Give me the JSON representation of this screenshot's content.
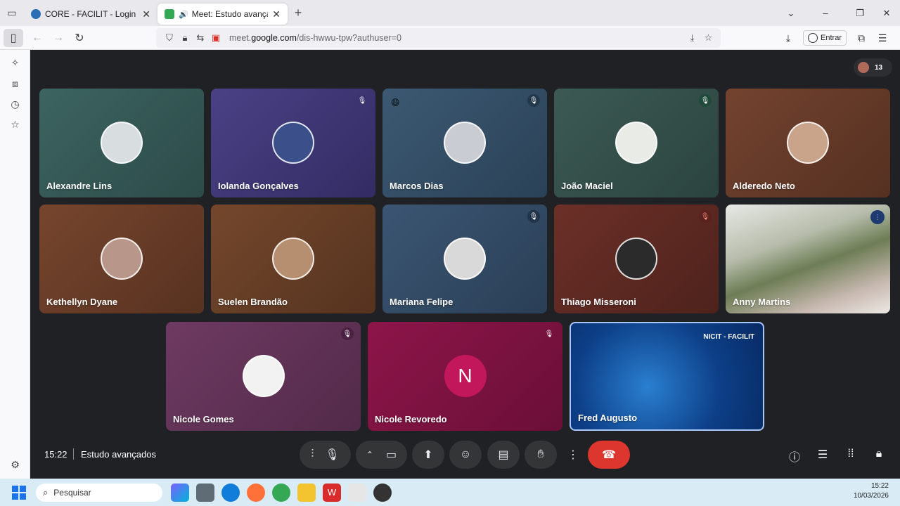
{
  "browser": {
    "tabs": [
      {
        "title": "CORE - FACILIT - Login",
        "active": false
      },
      {
        "title": "Meet: Estudo avançados",
        "active": true
      }
    ],
    "url_prefix": "meet.",
    "url_domain": "google.com",
    "url_path": "/dis-hwwu-tpw?authuser=0",
    "signin_label": "Entrar"
  },
  "meet": {
    "participant_count": "13",
    "tiles": [
      {
        "name": "Alexandre Lins",
        "muted": false
      },
      {
        "name": "Iolanda Gonçalves",
        "muted": true
      },
      {
        "name": "Marcos Dias",
        "muted": true,
        "emoji": "😄"
      },
      {
        "name": "João Maciel",
        "muted": true
      },
      {
        "name": "Alderedo Neto",
        "muted": false
      },
      {
        "name": "Kethellyn Dyane",
        "muted": false
      },
      {
        "name": "Suelen Brandão",
        "muted": false
      },
      {
        "name": "Mariana Felipe",
        "muted": true
      },
      {
        "name": "Thiago Misseroni",
        "muted": true
      },
      {
        "name": "Anny Martins",
        "speaking": true
      },
      {
        "name": "Nicole Gomes",
        "muted": true
      },
      {
        "name": "Nicole Revoredo",
        "muted": true,
        "initial": "N"
      },
      {
        "name": "Fred Augusto",
        "brand": "NICIT - FACILIT"
      }
    ],
    "time": "15:22",
    "meeting_name": "Estudo avançados"
  },
  "taskbar": {
    "search_placeholder": "Pesquisar",
    "time": "15:22",
    "date": "10/03/2026"
  },
  "colors": {
    "meet_bg": "#202124",
    "end_call": "#dc362e",
    "accent": "#8ab4f8"
  }
}
